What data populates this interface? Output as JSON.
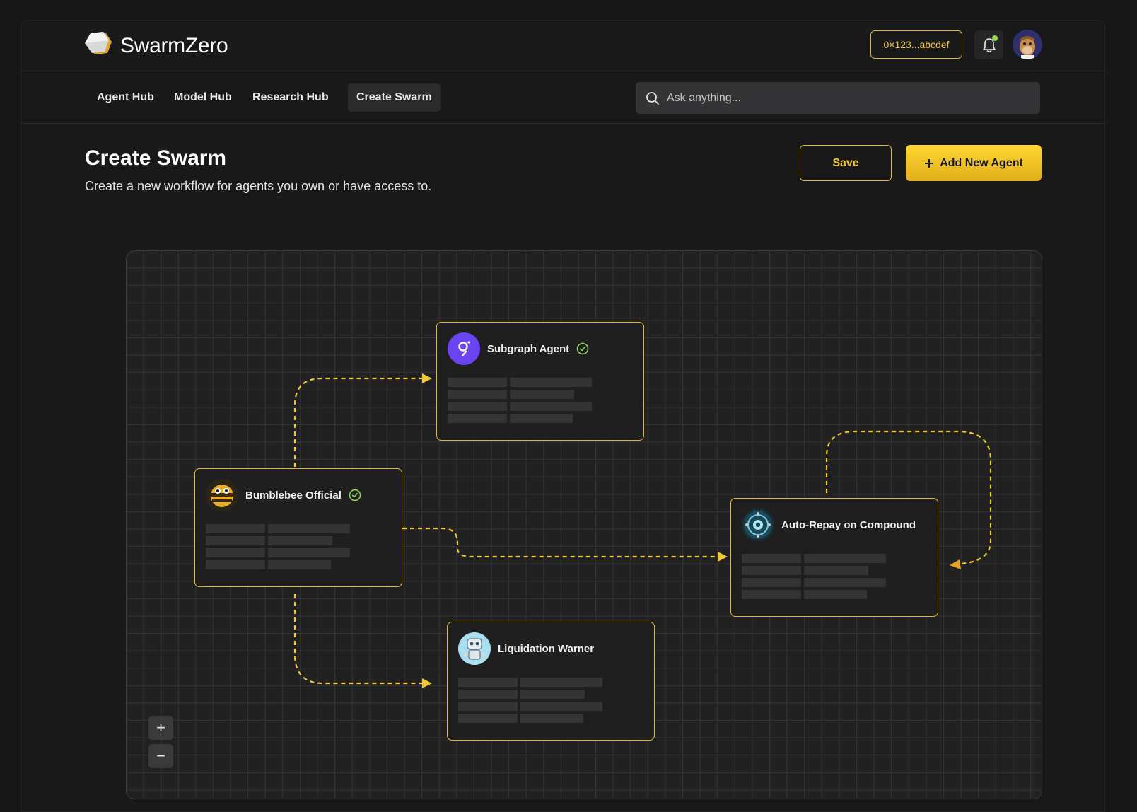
{
  "brand": {
    "name": "SwarmZero"
  },
  "header": {
    "wallet_address": "0×123...abcdef",
    "notification_dot_color": "#8fdb4a"
  },
  "nav": {
    "items": [
      {
        "label": "Agent Hub"
      },
      {
        "label": "Model Hub"
      },
      {
        "label": "Research Hub"
      },
      {
        "label": "Create Swarm",
        "active": true
      }
    ]
  },
  "search": {
    "placeholder": "Ask anything..."
  },
  "page": {
    "title": "Create Swarm",
    "subtitle": "Create a new workflow for agents you own or have access to."
  },
  "actions": {
    "save_label": "Save",
    "add_agent_label": "Add New Agent"
  },
  "canvas": {
    "nodes": [
      {
        "title": "Subgraph Agent",
        "verified": true,
        "icon": "subgraph-logo-icon"
      },
      {
        "title": "Bumblebee Official",
        "verified": true,
        "icon": "bumblebee-avatar-icon"
      },
      {
        "title": "Auto-Repay on Compound",
        "verified": false,
        "icon": "compound-avatar-icon"
      },
      {
        "title": "Liquidation Warner",
        "verified": false,
        "icon": "robot-avatar-icon"
      }
    ],
    "connections": [
      {
        "from": "Bumblebee Official",
        "to": "Subgraph Agent"
      },
      {
        "from": "Bumblebee Official",
        "to": "Auto-Repay on Compound"
      },
      {
        "from": "Bumblebee Official",
        "to": "Liquidation Warner"
      },
      {
        "from": "Auto-Repay on Compound",
        "to": "Auto-Repay on Compound"
      }
    ],
    "zoom_in_label": "+",
    "zoom_out_label": "−"
  },
  "colors": {
    "accent": "#e3b72a",
    "accent_text": "#f2c834",
    "background": "#191919",
    "node_background": "#1f1f20",
    "subgraph_purple": "#6b43f0",
    "verified_green": "#8fdb4a"
  }
}
